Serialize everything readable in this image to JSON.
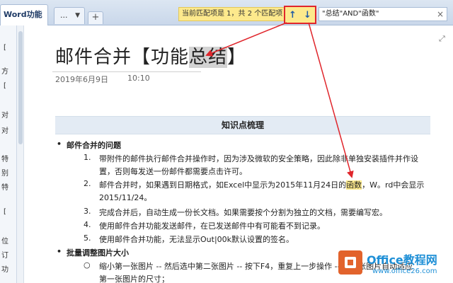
{
  "tabs": {
    "word_label": "Word功能",
    "more_label": "...",
    "add_label": "+"
  },
  "search": {
    "match_text": "当前匹配项是 1，共 2 个匹配项",
    "up_arrow": "↑",
    "down_arrow": "↓",
    "query": "\"总结\"AND\"函数\"",
    "clear": "×"
  },
  "left_strip": {
    "chars": [
      "[",
      "方",
      "[",
      "对",
      "对",
      "特",
      "别",
      "特",
      "[",
      "位",
      "订",
      "功"
    ]
  },
  "page": {
    "title_prefix": "邮件合并【功能",
    "title_highlight": "总结",
    "title_suffix": "】",
    "date": "2019年6月9日",
    "time": "10:10",
    "expand_icon": "⤢"
  },
  "content": {
    "section_heading": "知识点梳理",
    "bullet1": "邮件合并的问题",
    "items": [
      {
        "num": "1.",
        "l1": "带附件的邮件执行邮件合并操作时，因为涉及微软的安全策略，因此除非单独安装插件并作设",
        "l2": "置，否则每发送一份邮件都需要点击许可。"
      },
      {
        "num": "2.",
        "l1_pre": "邮件合并时，如果遇到日期格式，如Excel中显示为2015年11月24日的",
        "l1_hl": "函数",
        "l1_post": "，W。rd中会显示",
        "l2": "2015/11/24。"
      },
      {
        "num": "3.",
        "l1": "完成合并后，自动生成一份长文档。如果需要按个分割为独立的文档，需要编写宏。"
      },
      {
        "num": "4.",
        "l1": "使用邮件合并功能发送邮件，在已发送邮件中有可能看不到记录。"
      },
      {
        "num": "5.",
        "l1": "使用邮件合并功能，无法显示Out|00k默认设置的签名。"
      }
    ],
    "bullet2": "批量调整图片大小",
    "sub_bullet": "○",
    "sub_l1": "缩小第一张图片 -- 然后选中第二张图片 -- 按下F4，重复上一步操作 -- 第二张图片自动适应",
    "sub_l2": "第一张图片的尺寸；"
  },
  "watermark": {
    "name": "Office教程网",
    "url": "www.office26.com"
  },
  "colors": {
    "highlight_yellow": "#fde98c",
    "annotation_red": "#e0262c",
    "section_band": "#e3ebf4"
  }
}
